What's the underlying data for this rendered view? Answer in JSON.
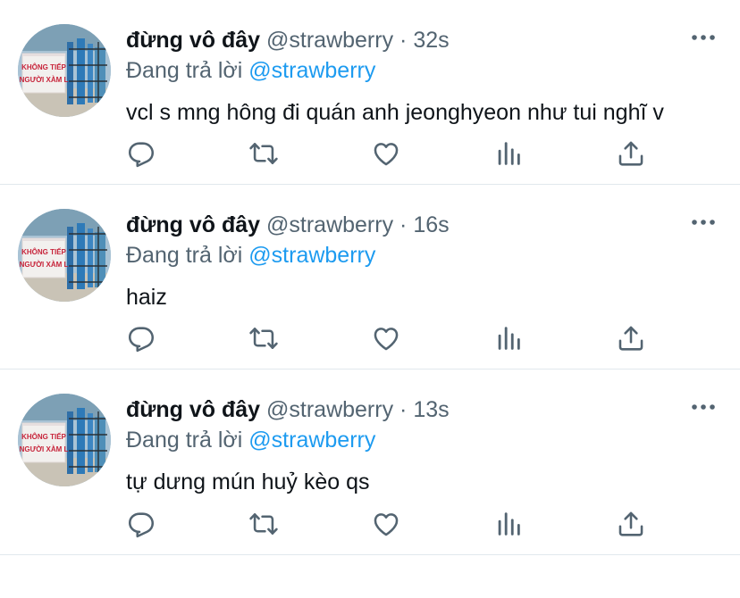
{
  "tweets": [
    {
      "name": "đừng vô đây",
      "handle": "@strawberry",
      "dot": "·",
      "time": "32s",
      "replying_prefix": "Đang trả lời",
      "replying_to": "@strawberry",
      "text": "vcl s mng hông đi quán anh jeonghyeon như tui nghĩ v",
      "avatar_sign_lines": [
        "KHÔNG TIẾP",
        "NGƯỜI XÀM L"
      ]
    },
    {
      "name": "đừng vô đây",
      "handle": "@strawberry",
      "dot": "·",
      "time": "16s",
      "replying_prefix": "Đang trả lời",
      "replying_to": "@strawberry",
      "text": "haiz",
      "avatar_sign_lines": [
        "KHÔNG TIẾP",
        "NGƯỜI XÀM L"
      ]
    },
    {
      "name": "đừng vô đây",
      "handle": "@strawberry",
      "dot": "·",
      "time": "13s",
      "replying_prefix": "Đang trả lời",
      "replying_to": "@strawberry",
      "text": "tự dưng mún huỷ kèo qs",
      "avatar_sign_lines": [
        "KHÔNG TIẾP",
        "NGƯỜI XÀM L"
      ]
    }
  ],
  "icons": [
    "reply-icon",
    "retweet-icon",
    "like-icon",
    "analytics-icon",
    "share-icon",
    "more-icon"
  ],
  "colors": {
    "text": "#0f1419",
    "secondary": "#536471",
    "mention": "#1d9bf0",
    "divider": "#e1e8ed"
  }
}
